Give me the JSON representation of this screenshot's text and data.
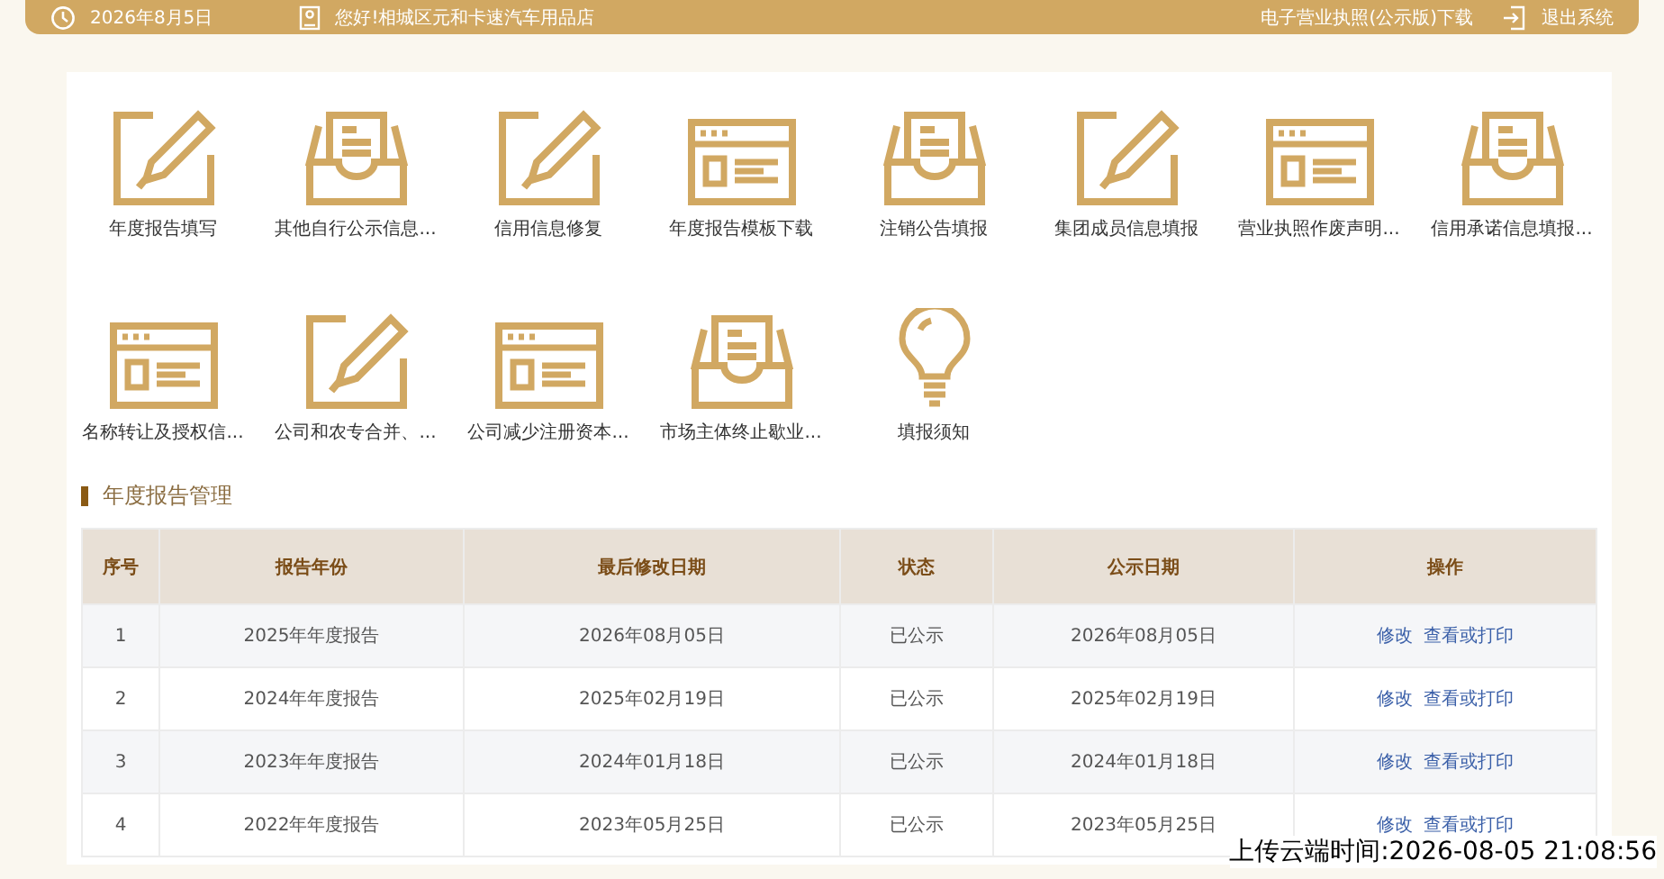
{
  "top_bar": {
    "date": "2026年8月5日",
    "greeting": "您好!相城区元和卡速汽车用品店",
    "license_link": "电子营业执照(公示版)下载",
    "logout": "退出系统"
  },
  "tiles": [
    {
      "kind": "pencil",
      "label": "年度报告填写"
    },
    {
      "kind": "tray",
      "label": "其他自行公示信息..."
    },
    {
      "kind": "pencil",
      "label": "信用信息修复"
    },
    {
      "kind": "window",
      "label": "年度报告模板下载"
    },
    {
      "kind": "tray",
      "label": "注销公告填报"
    },
    {
      "kind": "pencil",
      "label": "集团成员信息填报"
    },
    {
      "kind": "window",
      "label": "营业执照作废声明..."
    },
    {
      "kind": "tray",
      "label": "信用承诺信息填报..."
    },
    {
      "kind": "window",
      "label": "名称转让及授权信..."
    },
    {
      "kind": "pencil",
      "label": "公司和农专合并、..."
    },
    {
      "kind": "window",
      "label": "公司减少注册资本..."
    },
    {
      "kind": "tray",
      "label": "市场主体终止歇业..."
    },
    {
      "kind": "bulb",
      "label": "填报须知"
    }
  ],
  "section_title": "年度报告管理",
  "table": {
    "columns": [
      "序号",
      "报告年份",
      "最后修改日期",
      "状态",
      "公示日期",
      "操作"
    ],
    "rows": [
      {
        "cells": [
          "1",
          "2025年年度报告",
          "2026年08月05日",
          "已公示",
          "2026年08月05日"
        ],
        "actions": [
          "修改",
          "查看或打印"
        ]
      },
      {
        "cells": [
          "2",
          "2024年年度报告",
          "2025年02月19日",
          "已公示",
          "2025年02月19日"
        ],
        "actions": [
          "修改",
          "查看或打印"
        ]
      },
      {
        "cells": [
          "3",
          "2023年年度报告",
          "2024年01月18日",
          "已公示",
          "2024年01月18日"
        ],
        "actions": [
          "修改",
          "查看或打印"
        ]
      },
      {
        "cells": [
          "4",
          "2022年年度报告",
          "2023年05月25日",
          "已公示",
          "2023年05月25日"
        ],
        "actions": [
          "修改",
          "查看或打印"
        ]
      }
    ]
  },
  "upload_time": "上传云端时间:2026-08-05 21:08:56"
}
